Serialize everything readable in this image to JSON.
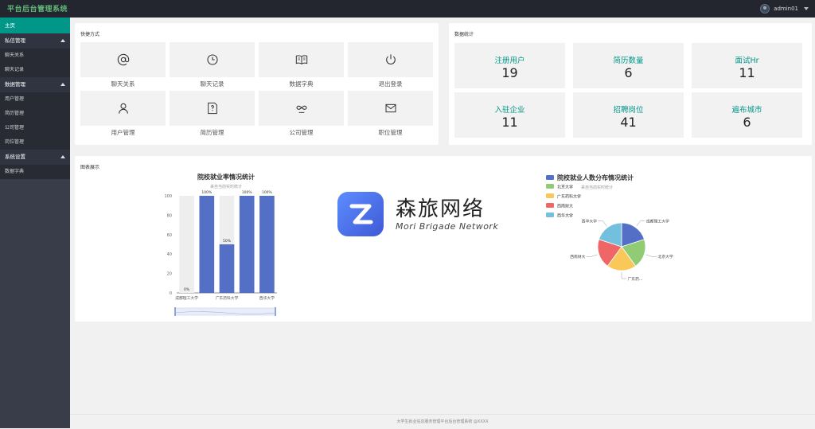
{
  "header": {
    "app_title": "平台后台管理系统",
    "username": "admin01"
  },
  "sidebar": {
    "home": "主页",
    "groups": [
      {
        "label": "私信管理",
        "items": [
          "聊天关系",
          "聊天记录"
        ]
      },
      {
        "label": "数据管理",
        "items": [
          "用户管理",
          "简历管理",
          "公司管理",
          "岗位管理"
        ]
      },
      {
        "label": "系统设置",
        "items": [
          "数据字典"
        ]
      }
    ]
  },
  "shortcuts": {
    "title": "快捷方式",
    "items": [
      {
        "label": "聊天关系",
        "icon": "at-icon"
      },
      {
        "label": "聊天记录",
        "icon": "clock-icon"
      },
      {
        "label": "数据字典",
        "icon": "book-icon"
      },
      {
        "label": "退出登录",
        "icon": "power-icon"
      },
      {
        "label": "用户管理",
        "icon": "user-icon"
      },
      {
        "label": "简历管理",
        "icon": "help-doc-icon"
      },
      {
        "label": "公司管理",
        "icon": "link-icon"
      },
      {
        "label": "职位管理",
        "icon": "mail-icon"
      }
    ]
  },
  "stats": {
    "title": "数据统计",
    "items": [
      {
        "label": "注册用户",
        "value": "19"
      },
      {
        "label": "简历数量",
        "value": "6"
      },
      {
        "label": "面试Hr",
        "value": "11"
      },
      {
        "label": "入驻企业",
        "value": "11"
      },
      {
        "label": "招聘岗位",
        "value": "41"
      },
      {
        "label": "遍布城市",
        "value": "6"
      }
    ]
  },
  "charts_panel": {
    "title": "图表展示"
  },
  "watermark": {
    "cn": "森旅网络",
    "en": "Mori Brigade Network"
  },
  "footer": {
    "text": "大学生就业信息服务管理平台后台管理系统 @XXXX"
  },
  "colors": {
    "accent": "#009688",
    "bar": "#5470c6",
    "bar_bg": "#eeeeee"
  },
  "chart_data": [
    {
      "type": "bar",
      "title": "院校就业率情况统计",
      "subtitle": "来自当前实时统计",
      "categories": [
        "成都理工大学",
        "",
        "广东药科大学",
        "",
        "西华大学"
      ],
      "values": [
        0,
        100,
        50,
        100,
        100
      ],
      "data_labels": [
        "0%",
        "100%",
        "50%",
        "100%",
        "100%"
      ],
      "ylim": [
        0,
        100
      ],
      "yticks": [
        0,
        20,
        40,
        60,
        80,
        100
      ],
      "background_bars": true,
      "datazoom_slider": true
    },
    {
      "type": "pie",
      "title": "院校就业人数分布情况统计",
      "subtitle": "来自当前实时统计",
      "legend": [
        "北京大学",
        "广东药科大学",
        "西南财大",
        "西华大学"
      ],
      "legend_series_marker": true,
      "slices": [
        {
          "name": "成都理工大学",
          "value": 1,
          "color": "#5470c6"
        },
        {
          "name": "北京大学",
          "value": 1,
          "color": "#91cc75"
        },
        {
          "name": "广东药...",
          "value": 1,
          "color": "#fac858"
        },
        {
          "name": "西南财大",
          "value": 1,
          "color": "#ee6666"
        },
        {
          "name": "西华大学",
          "value": 1,
          "color": "#73c0de"
        }
      ]
    }
  ]
}
